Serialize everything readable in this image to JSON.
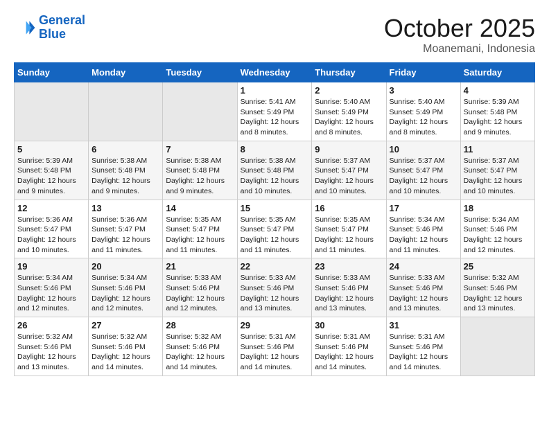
{
  "logo": {
    "line1": "General",
    "line2": "Blue"
  },
  "title": "October 2025",
  "subtitle": "Moanemani, Indonesia",
  "weekdays": [
    "Sunday",
    "Monday",
    "Tuesday",
    "Wednesday",
    "Thursday",
    "Friday",
    "Saturday"
  ],
  "weeks": [
    [
      {
        "day": "",
        "empty": true
      },
      {
        "day": "",
        "empty": true
      },
      {
        "day": "",
        "empty": true
      },
      {
        "day": "1",
        "sunrise": "Sunrise: 5:41 AM",
        "sunset": "Sunset: 5:49 PM",
        "daylight": "Daylight: 12 hours and 8 minutes."
      },
      {
        "day": "2",
        "sunrise": "Sunrise: 5:40 AM",
        "sunset": "Sunset: 5:49 PM",
        "daylight": "Daylight: 12 hours and 8 minutes."
      },
      {
        "day": "3",
        "sunrise": "Sunrise: 5:40 AM",
        "sunset": "Sunset: 5:49 PM",
        "daylight": "Daylight: 12 hours and 8 minutes."
      },
      {
        "day": "4",
        "sunrise": "Sunrise: 5:39 AM",
        "sunset": "Sunset: 5:48 PM",
        "daylight": "Daylight: 12 hours and 9 minutes."
      }
    ],
    [
      {
        "day": "5",
        "sunrise": "Sunrise: 5:39 AM",
        "sunset": "Sunset: 5:48 PM",
        "daylight": "Daylight: 12 hours and 9 minutes."
      },
      {
        "day": "6",
        "sunrise": "Sunrise: 5:38 AM",
        "sunset": "Sunset: 5:48 PM",
        "daylight": "Daylight: 12 hours and 9 minutes."
      },
      {
        "day": "7",
        "sunrise": "Sunrise: 5:38 AM",
        "sunset": "Sunset: 5:48 PM",
        "daylight": "Daylight: 12 hours and 9 minutes."
      },
      {
        "day": "8",
        "sunrise": "Sunrise: 5:38 AM",
        "sunset": "Sunset: 5:48 PM",
        "daylight": "Daylight: 12 hours and 10 minutes."
      },
      {
        "day": "9",
        "sunrise": "Sunrise: 5:37 AM",
        "sunset": "Sunset: 5:47 PM",
        "daylight": "Daylight: 12 hours and 10 minutes."
      },
      {
        "day": "10",
        "sunrise": "Sunrise: 5:37 AM",
        "sunset": "Sunset: 5:47 PM",
        "daylight": "Daylight: 12 hours and 10 minutes."
      },
      {
        "day": "11",
        "sunrise": "Sunrise: 5:37 AM",
        "sunset": "Sunset: 5:47 PM",
        "daylight": "Daylight: 12 hours and 10 minutes."
      }
    ],
    [
      {
        "day": "12",
        "sunrise": "Sunrise: 5:36 AM",
        "sunset": "Sunset: 5:47 PM",
        "daylight": "Daylight: 12 hours and 10 minutes."
      },
      {
        "day": "13",
        "sunrise": "Sunrise: 5:36 AM",
        "sunset": "Sunset: 5:47 PM",
        "daylight": "Daylight: 12 hours and 11 minutes."
      },
      {
        "day": "14",
        "sunrise": "Sunrise: 5:35 AM",
        "sunset": "Sunset: 5:47 PM",
        "daylight": "Daylight: 12 hours and 11 minutes."
      },
      {
        "day": "15",
        "sunrise": "Sunrise: 5:35 AM",
        "sunset": "Sunset: 5:47 PM",
        "daylight": "Daylight: 12 hours and 11 minutes."
      },
      {
        "day": "16",
        "sunrise": "Sunrise: 5:35 AM",
        "sunset": "Sunset: 5:47 PM",
        "daylight": "Daylight: 12 hours and 11 minutes."
      },
      {
        "day": "17",
        "sunrise": "Sunrise: 5:34 AM",
        "sunset": "Sunset: 5:46 PM",
        "daylight": "Daylight: 12 hours and 11 minutes."
      },
      {
        "day": "18",
        "sunrise": "Sunrise: 5:34 AM",
        "sunset": "Sunset: 5:46 PM",
        "daylight": "Daylight: 12 hours and 12 minutes."
      }
    ],
    [
      {
        "day": "19",
        "sunrise": "Sunrise: 5:34 AM",
        "sunset": "Sunset: 5:46 PM",
        "daylight": "Daylight: 12 hours and 12 minutes."
      },
      {
        "day": "20",
        "sunrise": "Sunrise: 5:34 AM",
        "sunset": "Sunset: 5:46 PM",
        "daylight": "Daylight: 12 hours and 12 minutes."
      },
      {
        "day": "21",
        "sunrise": "Sunrise: 5:33 AM",
        "sunset": "Sunset: 5:46 PM",
        "daylight": "Daylight: 12 hours and 12 minutes."
      },
      {
        "day": "22",
        "sunrise": "Sunrise: 5:33 AM",
        "sunset": "Sunset: 5:46 PM",
        "daylight": "Daylight: 12 hours and 13 minutes."
      },
      {
        "day": "23",
        "sunrise": "Sunrise: 5:33 AM",
        "sunset": "Sunset: 5:46 PM",
        "daylight": "Daylight: 12 hours and 13 minutes."
      },
      {
        "day": "24",
        "sunrise": "Sunrise: 5:33 AM",
        "sunset": "Sunset: 5:46 PM",
        "daylight": "Daylight: 12 hours and 13 minutes."
      },
      {
        "day": "25",
        "sunrise": "Sunrise: 5:32 AM",
        "sunset": "Sunset: 5:46 PM",
        "daylight": "Daylight: 12 hours and 13 minutes."
      }
    ],
    [
      {
        "day": "26",
        "sunrise": "Sunrise: 5:32 AM",
        "sunset": "Sunset: 5:46 PM",
        "daylight": "Daylight: 12 hours and 13 minutes."
      },
      {
        "day": "27",
        "sunrise": "Sunrise: 5:32 AM",
        "sunset": "Sunset: 5:46 PM",
        "daylight": "Daylight: 12 hours and 14 minutes."
      },
      {
        "day": "28",
        "sunrise": "Sunrise: 5:32 AM",
        "sunset": "Sunset: 5:46 PM",
        "daylight": "Daylight: 12 hours and 14 minutes."
      },
      {
        "day": "29",
        "sunrise": "Sunrise: 5:31 AM",
        "sunset": "Sunset: 5:46 PM",
        "daylight": "Daylight: 12 hours and 14 minutes."
      },
      {
        "day": "30",
        "sunrise": "Sunrise: 5:31 AM",
        "sunset": "Sunset: 5:46 PM",
        "daylight": "Daylight: 12 hours and 14 minutes."
      },
      {
        "day": "31",
        "sunrise": "Sunrise: 5:31 AM",
        "sunset": "Sunset: 5:46 PM",
        "daylight": "Daylight: 12 hours and 14 minutes."
      },
      {
        "day": "",
        "empty": true
      }
    ]
  ]
}
